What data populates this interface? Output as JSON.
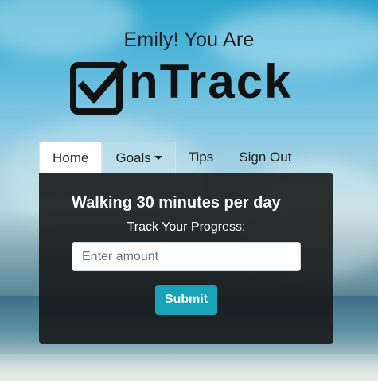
{
  "header": {
    "greeting": "Emily! You Are",
    "logo_text": "nTrack"
  },
  "nav": {
    "items": [
      {
        "label": "Home",
        "active": true
      },
      {
        "label": "Goals",
        "dropdown": true
      },
      {
        "label": "Tips"
      },
      {
        "label": "Sign Out"
      }
    ]
  },
  "goal": {
    "title": "Walking 30 minutes per day",
    "progress_label": "Track Your Progress:",
    "input_placeholder": "Enter amount",
    "input_value": "",
    "submit_label": "Submit"
  },
  "colors": {
    "accent": "#17a2b8",
    "panel": "#141414",
    "text_dark": "#222222"
  },
  "icons": {
    "logo": "checkbox-check-icon",
    "dropdown": "caret-down-icon"
  }
}
